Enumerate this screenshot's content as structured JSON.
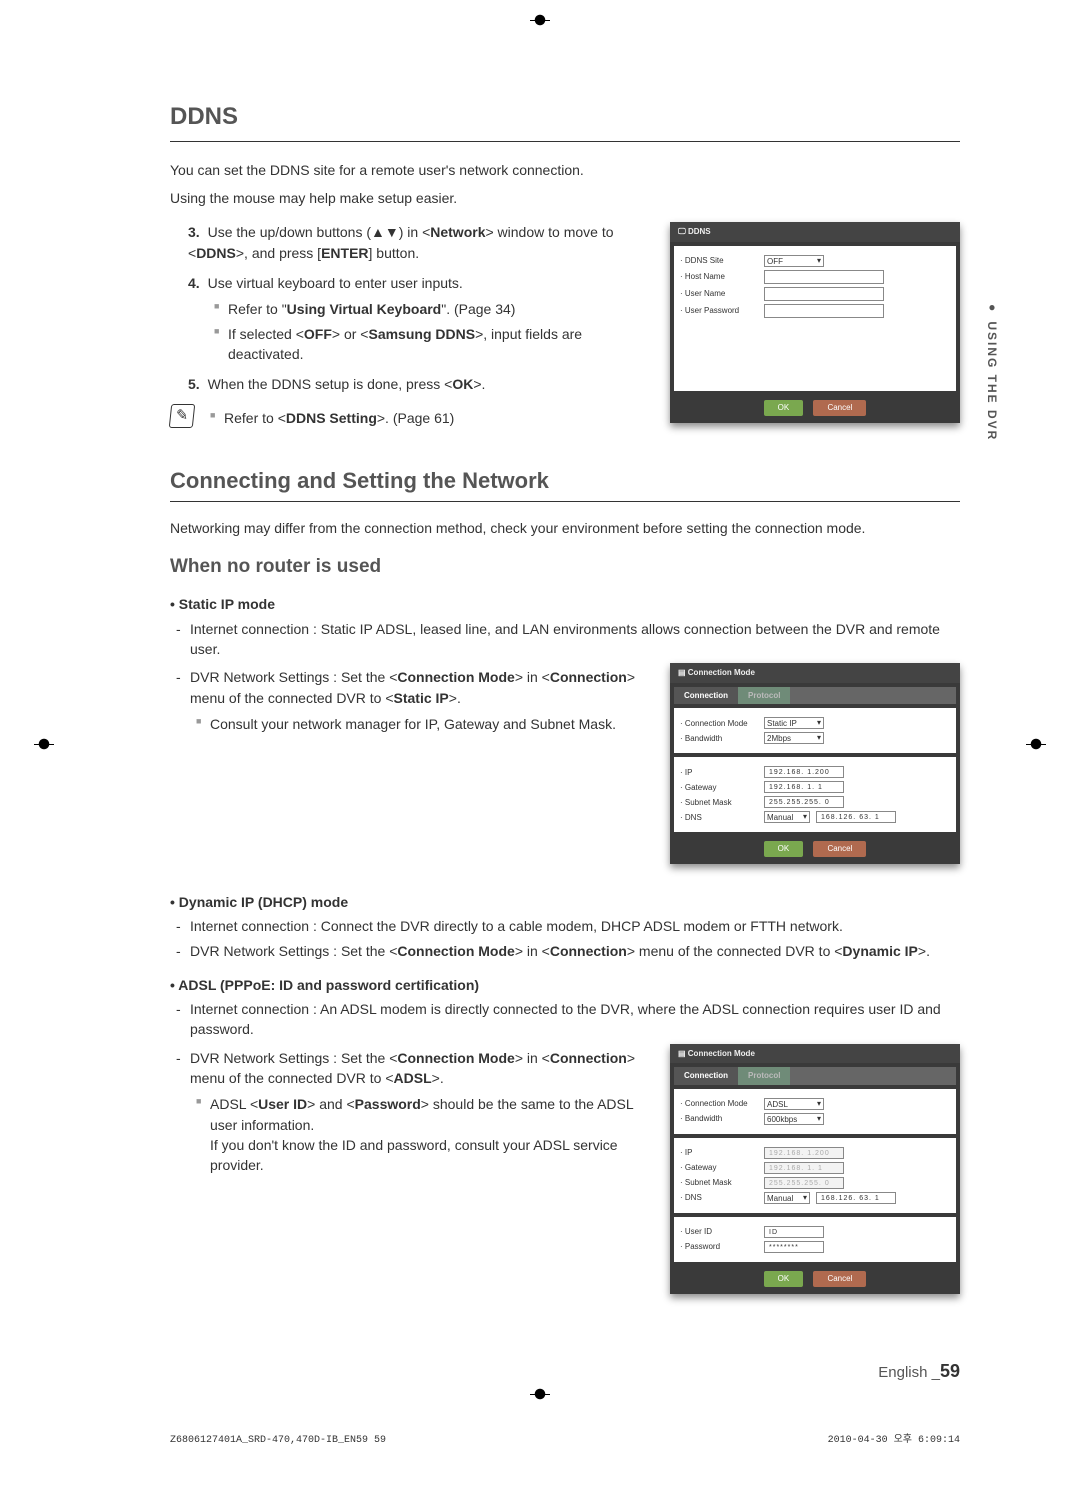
{
  "side_tab": "● USING THE DVR",
  "ddns": {
    "title": "DDNS",
    "intro": "You can set the DDNS site for a remote user's network connection.",
    "note": "Using the mouse may help make setup easier.",
    "steps": {
      "s3": {
        "num": "3.",
        "text_a": "Use the up/down buttons (▲▼) in <",
        "text_b": "Network",
        "text_c": "> window to move to <",
        "text_d": "DDNS",
        "text_e": ">, and press [",
        "text_f": "ENTER",
        "text_g": "] button."
      },
      "s4": {
        "num": "4.",
        "text": "Use virtual keyboard to enter user inputs.",
        "sub1_a": "Refer to \"",
        "sub1_b": "Using Virtual Keyboard",
        "sub1_c": "\". (Page 34)",
        "sub2_a": "If selected <",
        "sub2_b": "OFF",
        "sub2_c": "> or <",
        "sub2_d": "Samsung DDNS",
        "sub2_e": ">, input fields are deactivated."
      },
      "s5": {
        "num": "5.",
        "text_a": "When the DDNS setup is done, press <",
        "text_b": "OK",
        "text_c": ">."
      }
    },
    "tip_a": "Refer to <",
    "tip_b": "DDNS Setting",
    "tip_c": ">. (Page 61)",
    "ui": {
      "title": "DDNS",
      "rows": {
        "site": "· DDNS Site",
        "site_val": "OFF",
        "host": "· Host Name",
        "user": "· User Name",
        "pass": "· User Password"
      },
      "ok": "OK",
      "cancel": "Cancel"
    }
  },
  "network": {
    "title": "Connecting and Setting the Network",
    "intro": "Networking may differ from the connection method, check your environment before setting the connection mode.",
    "norouter": {
      "title": "When no router is used",
      "static": {
        "heading": "• Static IP mode",
        "b1": "Internet connection : Static IP ADSL, leased line, and LAN environments allows connection between the DVR and remote user.",
        "b2_a": "DVR Network Settings : Set the <",
        "b2_b": "Connection Mode",
        "b2_c": "> in <",
        "b2_d": "Connection",
        "b2_e": "> menu of the connected DVR to <",
        "b2_f": "Static IP",
        "b2_g": ">.",
        "sub": "Consult your network manager for IP, Gateway and Subnet Mask."
      },
      "dhcp": {
        "heading": "• Dynamic IP (DHCP) mode",
        "b1": "Internet connection : Connect the DVR directly to a cable modem, DHCP ADSL modem or FTTH network.",
        "b2_a": "DVR Network Settings : Set the <",
        "b2_b": "Connection Mode",
        "b2_c": "> in <",
        "b2_d": "Connection",
        "b2_e": "> menu of the connected DVR to <",
        "b2_f": "Dynamic IP",
        "b2_g": ">."
      },
      "adsl": {
        "heading": "• ADSL (PPPoE: ID and password certification)",
        "b1": "Internet connection : An ADSL modem is directly connected to the DVR, where the ADSL connection requires user ID and password.",
        "b2_a": "DVR Network Settings : Set the <",
        "b2_b": "Connection Mode",
        "b2_c": "> in <",
        "b2_d": "Connection",
        "b2_e": "> menu of the connected DVR to <",
        "b2_f": "ADSL",
        "b2_g": ">.",
        "sub_a": "ADSL <",
        "sub_b": "User ID",
        "sub_c": "> and <",
        "sub_d": "Password",
        "sub_e": "> should be the same to the ADSL user information.",
        "sub2": "If you don't know the ID and password, consult your ADSL service provider."
      }
    },
    "ui_conn": {
      "title": "Connection Mode",
      "tab1": "Connection",
      "tab2": "Protocol",
      "mode_lbl": "· Connection Mode",
      "mode_val_static": "Static IP",
      "mode_val_adsl": "ADSL",
      "bw_lbl": "· Bandwidth",
      "bw_val_2": "2Mbps",
      "bw_val_600": "600kbps",
      "ip_lbl": "· IP",
      "gw_lbl": "· Gateway",
      "sm_lbl": "· Subnet Mask",
      "dns_lbl": "· DNS",
      "dns_mode": "Manual",
      "ip_val": "192.168.  1.200",
      "gw_val": "192.168.  1.   1",
      "sm_val": "255.255.255.  0",
      "dns_val": "168.126. 63.   1",
      "uid_lbl": "· User ID",
      "uid_val": "ID",
      "pw_lbl": "· Password",
      "pw_val": "********",
      "ok": "OK",
      "cancel": "Cancel"
    }
  },
  "footer": {
    "lang": "English _",
    "page": "59"
  },
  "print": {
    "left": "Z6806127401A_SRD-470,470D-IB_EN59   59",
    "right": "2010-04-30   오후 6:09:14"
  }
}
